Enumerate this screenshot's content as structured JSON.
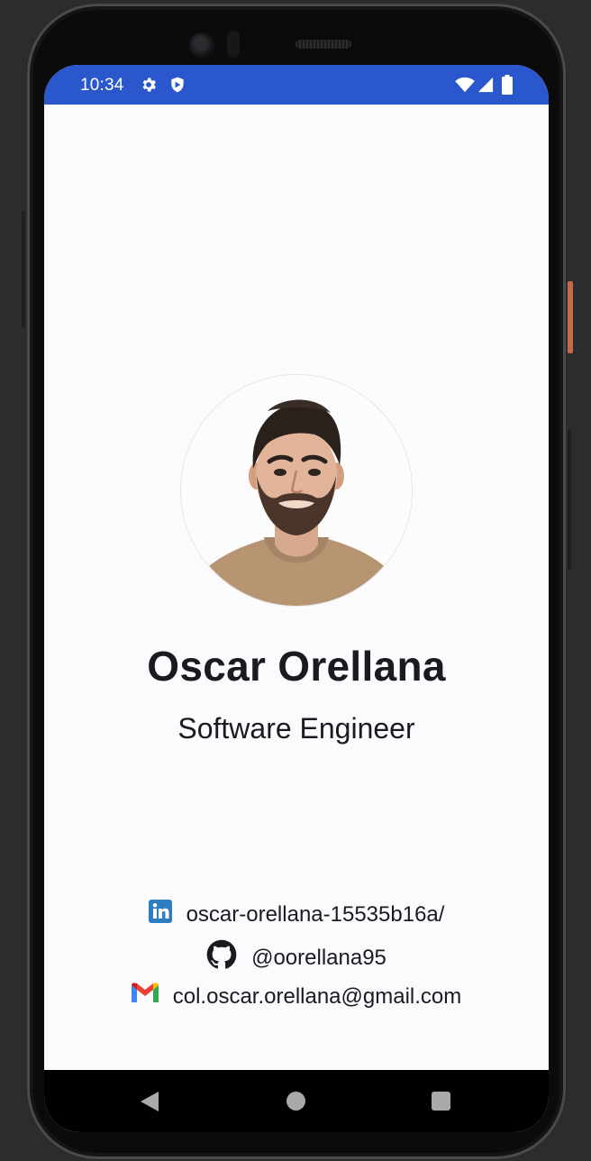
{
  "status_bar": {
    "time": "10:34",
    "icons": [
      "settings-icon",
      "shield-icon",
      "wifi-icon",
      "signal-icon",
      "battery-icon"
    ],
    "color": "#2a57cc"
  },
  "profile": {
    "name": "Oscar Orellana",
    "title": "Software Engineer"
  },
  "contacts": {
    "linkedin": {
      "icon": "linkedin-icon",
      "text": "oscar-orellana-15535b16a/"
    },
    "github": {
      "icon": "github-icon",
      "text": "@oorellana95"
    },
    "email": {
      "icon": "gmail-icon",
      "text": "col.oscar.orellana@gmail.com"
    }
  },
  "nav_bar": {
    "icons": [
      "back-icon",
      "home-icon",
      "recents-icon"
    ]
  }
}
